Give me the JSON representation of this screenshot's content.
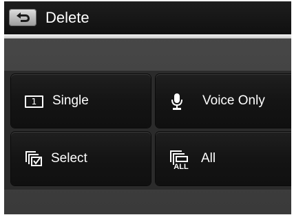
{
  "header": {
    "title": "Delete",
    "back_icon": "back-arrow-icon"
  },
  "menu": {
    "items": [
      {
        "label": "Single",
        "icon": "single-frame-icon",
        "icon_text": "1"
      },
      {
        "label": "Voice Only",
        "icon": "microphone-icon"
      },
      {
        "label": "Select",
        "icon": "select-checkbox-icon"
      },
      {
        "label": "All",
        "icon": "all-frames-icon",
        "icon_text": "ALL"
      }
    ]
  },
  "colors": {
    "background": "#444444",
    "header": "#151515",
    "tile": "#161616",
    "text": "#ffffff"
  }
}
